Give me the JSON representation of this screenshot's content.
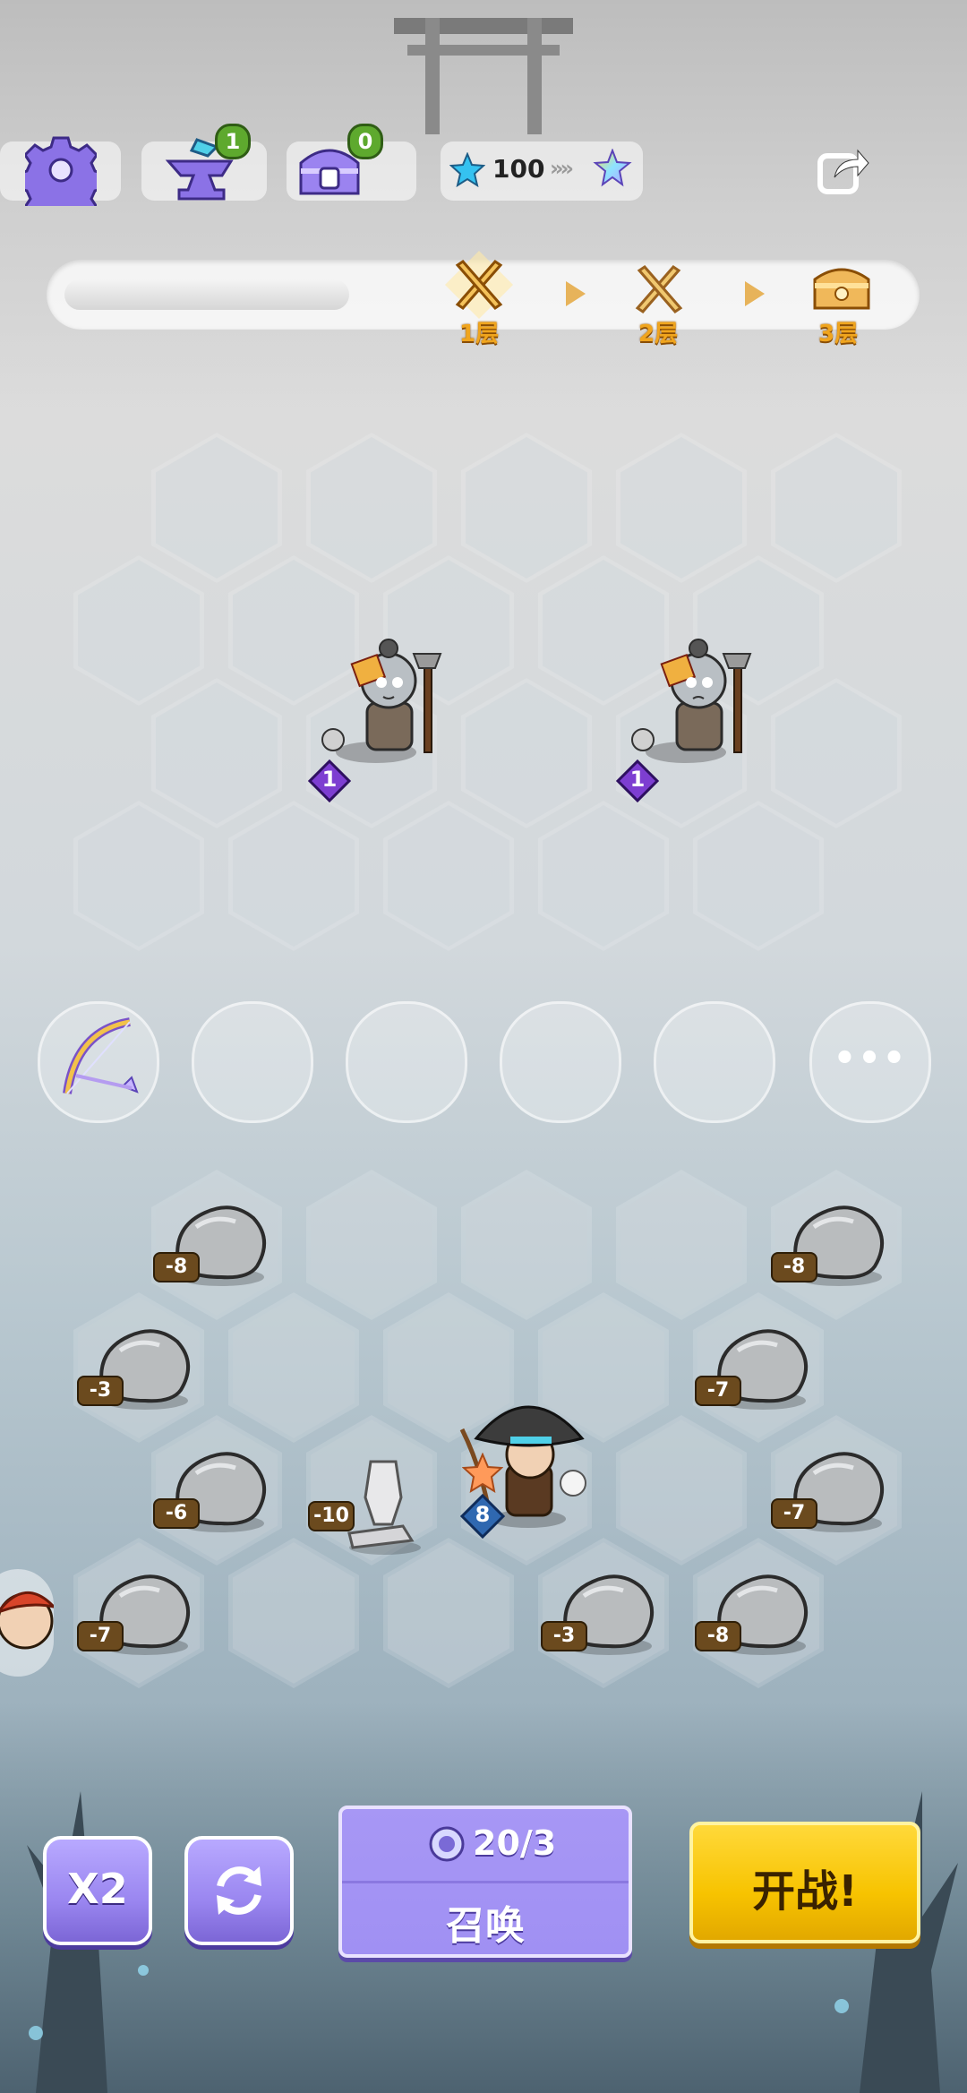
{
  "hud": {
    "settings_icon": "gear-icon",
    "anvil_icon": "anvil-icon",
    "anvil_badge": "1",
    "chest_icon": "chest-icon",
    "chest_badge": "0",
    "star_currency_icon": "blue-star-icon",
    "star_count": "100",
    "star_upgrade_icon": "rainbow-star-icon",
    "share_icon": "share-icon"
  },
  "progress": {
    "current_fraction": 0.34,
    "floors": [
      {
        "label": "1层",
        "icon": "crossed-swords-icon",
        "active": true
      },
      {
        "label": "2层",
        "icon": "crossed-swords-icon",
        "active": false
      },
      {
        "label": "3层",
        "icon": "treasure-chest-icon",
        "active": false
      }
    ]
  },
  "enemies": [
    {
      "name": "zombie-miner",
      "level": "1"
    },
    {
      "name": "zombie-miner",
      "level": "1"
    }
  ],
  "bench": {
    "item_icon": "golden-bow-icon",
    "more_label": "•••"
  },
  "rocks": [
    {
      "value": "-8"
    },
    {
      "value": "-8"
    },
    {
      "value": "-3"
    },
    {
      "value": "-7"
    },
    {
      "value": "-6"
    },
    {
      "value": "-7"
    },
    {
      "value": "-7"
    },
    {
      "value": "-3"
    },
    {
      "value": "-8"
    }
  ],
  "armor_piece": {
    "value": "-10"
  },
  "hero": {
    "name": "straw-hat-archer",
    "level": "8"
  },
  "side_avatar": "red-hair-hero-avatar",
  "controls": {
    "speed_label": "X2",
    "refresh_icon": "refresh-icon",
    "summon_cost": "20/3",
    "summon_coin_icon": "spirit-coin-icon",
    "summon_label": "召唤",
    "start_label": "开战!"
  }
}
